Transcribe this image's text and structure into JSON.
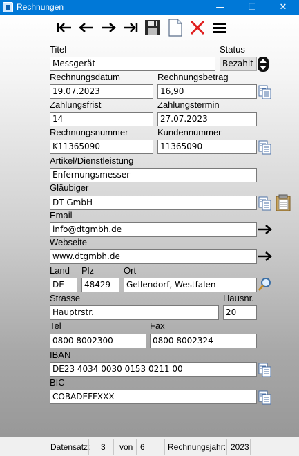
{
  "window": {
    "title": "Rechnungen",
    "controls": {
      "minimize": "—",
      "maximize": "☐",
      "close": "✕"
    }
  },
  "toolbar": [
    "first-record",
    "previous-record",
    "next-record",
    "last-record",
    "save",
    "new-document",
    "delete",
    "menu"
  ],
  "form": {
    "titel": {
      "label": "Titel",
      "value": "Messgerät"
    },
    "status": {
      "label": "Status",
      "value": "Bezahlt"
    },
    "rechnungsdatum": {
      "label": "Rechnungsdatum",
      "value": "19.07.2023"
    },
    "rechnungsbetrag": {
      "label": "Rechnungsbetrag",
      "value": "16,90"
    },
    "zahlungsfrist": {
      "label": "Zahlungsfrist",
      "value": "14"
    },
    "zahlungstermin": {
      "label": "Zahlungstermin",
      "value": "27.07.2023"
    },
    "rechnungsnummer": {
      "label": "Rechnungsnummer",
      "value": "K11365090"
    },
    "kundennummer": {
      "label": "Kundennummer",
      "value": "11365090"
    },
    "artikel": {
      "label": "Artikel/Dienstleistung",
      "value": "Enfernungsmesser"
    },
    "glaeubiger": {
      "label": "Gläubiger",
      "value": "DT GmbH"
    },
    "email": {
      "label": "Email",
      "value": "info@dtgmbh.de"
    },
    "webseite": {
      "label": "Webseite",
      "value": "www.dtgmbh.de"
    },
    "land": {
      "label": "Land",
      "value": "DE"
    },
    "plz": {
      "label": "Plz",
      "value": "48429"
    },
    "ort": {
      "label": "Ort",
      "value": "Gellendorf, Westfalen"
    },
    "strasse": {
      "label": "Strasse",
      "value": "Hauptrstr."
    },
    "hausnr": {
      "label": "Hausnr.",
      "value": "20"
    },
    "tel": {
      "label": "Tel",
      "value": "0800 8002300"
    },
    "fax": {
      "label": "Fax",
      "value": "0800 8002324"
    },
    "iban": {
      "label": "IBAN",
      "value": "DE23 4034 0030 0153 0211 00"
    },
    "bic": {
      "label": "BIC",
      "value": "COBADEFFXXX"
    }
  },
  "statusbar": {
    "datensatz_label": "Datensatz:",
    "current": "3",
    "von_label": "von",
    "total": "6",
    "jahr_label": "Rechnungsjahr:",
    "jahr": "2023"
  },
  "colors": {
    "titlebar": "#0078d7",
    "close_red": "#e02020",
    "arrow": "#000000"
  }
}
